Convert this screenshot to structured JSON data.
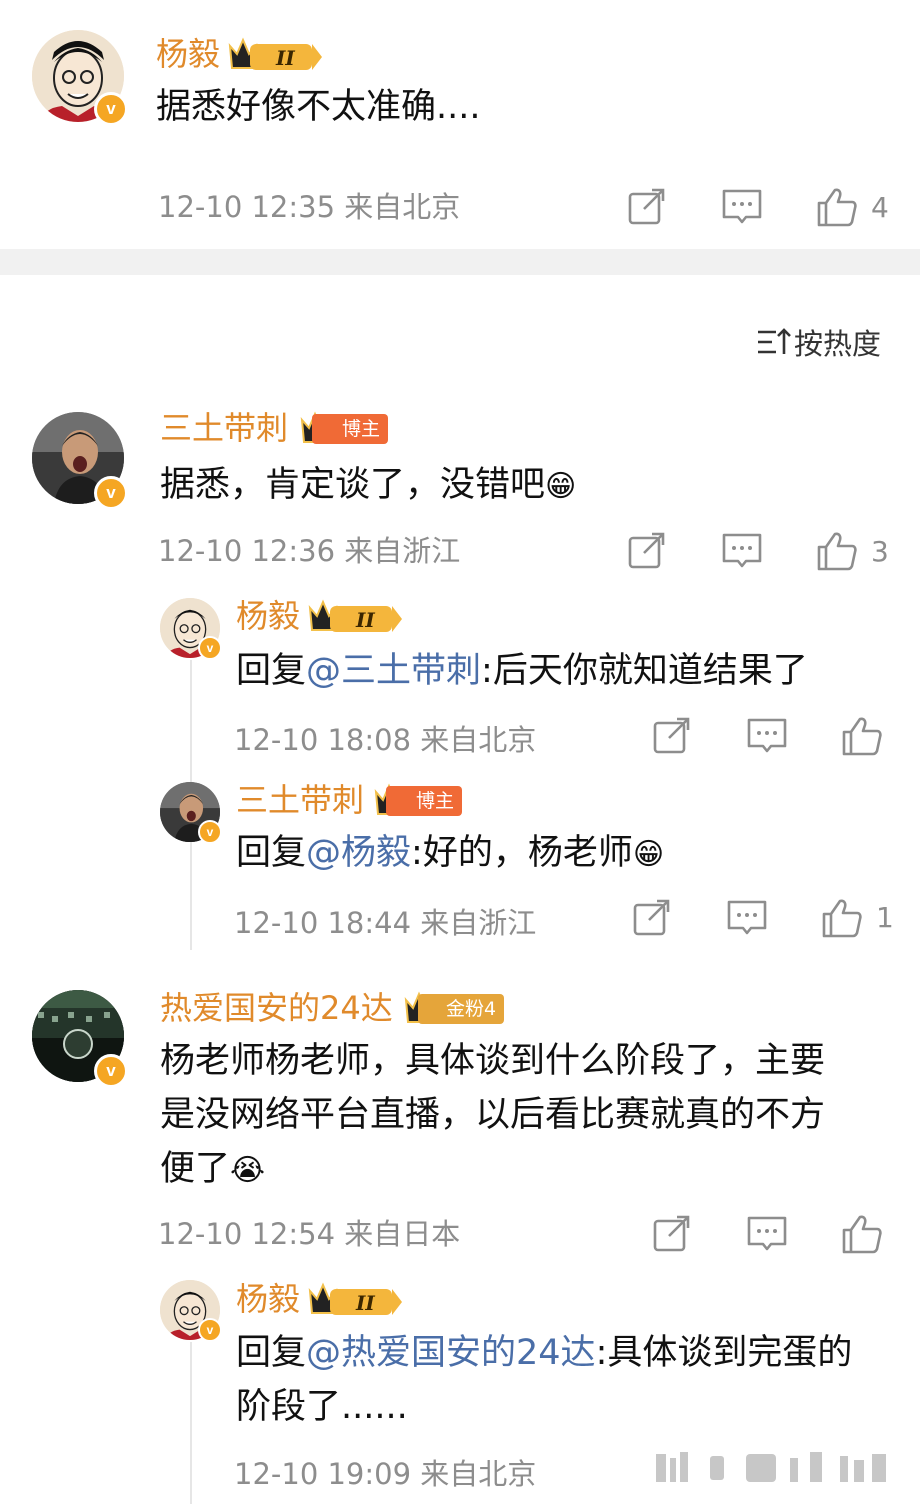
{
  "sort": {
    "label": "按热度"
  },
  "colors": {
    "name": "#e08a2b",
    "mention": "#4a6ea8",
    "meta": "#8d8d8d",
    "badge": "#f5a623"
  },
  "comments": [
    {
      "name": "杨毅",
      "tag": "II",
      "text": "据悉好像不太准确....",
      "time": "12-10 12:35",
      "location": "来自北京",
      "likes": "4"
    },
    {
      "name": "三土带刺",
      "tag": "博主",
      "text": "据悉，肯定谈了，没错吧",
      "emoji": "😁",
      "time": "12-10 12:36",
      "location": "来自浙江",
      "likes": "3",
      "replies": [
        {
          "name": "杨毅",
          "tag": "II",
          "reply_prefix": "回复",
          "mention": "@三土带刺",
          "text": ":后天你就知道结果了",
          "time": "12-10 18:08",
          "location": "来自北京",
          "likes": ""
        },
        {
          "name": "三土带刺",
          "tag": "博主",
          "reply_prefix": "回复",
          "mention": "@杨毅",
          "text": ":好的，杨老师",
          "emoji": "😁",
          "time": "12-10 18:44",
          "location": "来自浙江",
          "likes": "1"
        }
      ]
    },
    {
      "name": "热爱国安的24达",
      "tag": "金粉4",
      "text_lines": [
        "杨老师杨老师，具体谈到什么阶段了，主要",
        "是没网络平台直播，以后看比赛就真的不方",
        "便了"
      ],
      "emoji": "😭",
      "time": "12-10 12:54",
      "location": "来自日本",
      "likes": "",
      "replies": [
        {
          "name": "杨毅",
          "tag": "II",
          "reply_prefix": "回复",
          "mention": "@热爱国安的24达",
          "text_lines": [
            ":具体谈到完蛋的",
            "阶段了......"
          ],
          "time": "12-10 19:09",
          "location": "来自北京"
        }
      ]
    }
  ]
}
